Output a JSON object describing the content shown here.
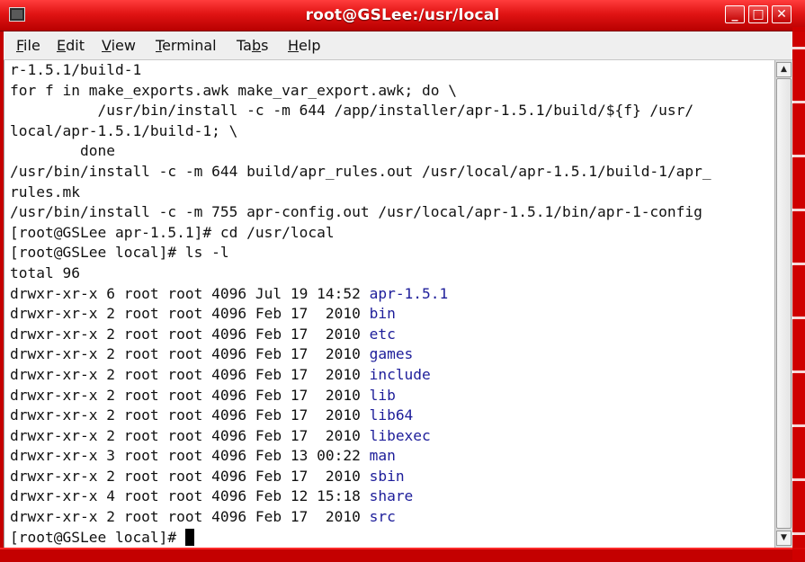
{
  "window": {
    "title": "root@GSLee:/usr/local",
    "controls": {
      "minimize": "_",
      "maximize": "□",
      "close": "✕"
    }
  },
  "menubar": {
    "items": [
      {
        "label": "File",
        "mnemonic": "F",
        "rest": "ile"
      },
      {
        "label": "Edit",
        "mnemonic": "E",
        "rest": "dit"
      },
      {
        "label": "View",
        "mnemonic": "V",
        "rest": "iew"
      },
      {
        "label": "Terminal",
        "mnemonic": "T",
        "rest": "erminal"
      },
      {
        "label": "Tabs",
        "pre": "Ta",
        "mnemonic": "b",
        "rest": "s"
      },
      {
        "label": "Help",
        "mnemonic": "H",
        "rest": "elp"
      }
    ]
  },
  "terminal": {
    "lines": [
      "r-1.5.1/build-1",
      "for f in make_exports.awk make_var_export.awk; do \\",
      "          /usr/bin/install -c -m 644 /app/installer/apr-1.5.1/build/${f} /usr/",
      "local/apr-1.5.1/build-1; \\",
      "        done",
      "/usr/bin/install -c -m 644 build/apr_rules.out /usr/local/apr-1.5.1/build-1/apr_",
      "rules.mk",
      "/usr/bin/install -c -m 755 apr-config.out /usr/local/apr-1.5.1/bin/apr-1-config",
      "[root@GSLee apr-1.5.1]# cd /usr/local",
      "[root@GSLee local]# ls -l",
      "total 96"
    ],
    "listing": [
      {
        "perms": "drwxr-xr-x 6 root root 4096 Jul 19 14:52 ",
        "name": "apr-1.5.1"
      },
      {
        "perms": "drwxr-xr-x 2 root root 4096 Feb 17  2010 ",
        "name": "bin"
      },
      {
        "perms": "drwxr-xr-x 2 root root 4096 Feb 17  2010 ",
        "name": "etc"
      },
      {
        "perms": "drwxr-xr-x 2 root root 4096 Feb 17  2010 ",
        "name": "games"
      },
      {
        "perms": "drwxr-xr-x 2 root root 4096 Feb 17  2010 ",
        "name": "include"
      },
      {
        "perms": "drwxr-xr-x 2 root root 4096 Feb 17  2010 ",
        "name": "lib"
      },
      {
        "perms": "drwxr-xr-x 2 root root 4096 Feb 17  2010 ",
        "name": "lib64"
      },
      {
        "perms": "drwxr-xr-x 2 root root 4096 Feb 17  2010 ",
        "name": "libexec"
      },
      {
        "perms": "drwxr-xr-x 3 root root 4096 Feb 13 00:22 ",
        "name": "man"
      },
      {
        "perms": "drwxr-xr-x 2 root root 4096 Feb 17  2010 ",
        "name": "sbin"
      },
      {
        "perms": "drwxr-xr-x 4 root root 4096 Feb 12 15:18 ",
        "name": "share"
      },
      {
        "perms": "drwxr-xr-x 2 root root 4096 Feb 17  2010 ",
        "name": "src"
      }
    ],
    "prompt": "[root@GSLee local]# "
  },
  "colors": {
    "titlebar": "#e11414",
    "directory": "#1d1d9a",
    "terminal_bg": "#ffffff"
  }
}
